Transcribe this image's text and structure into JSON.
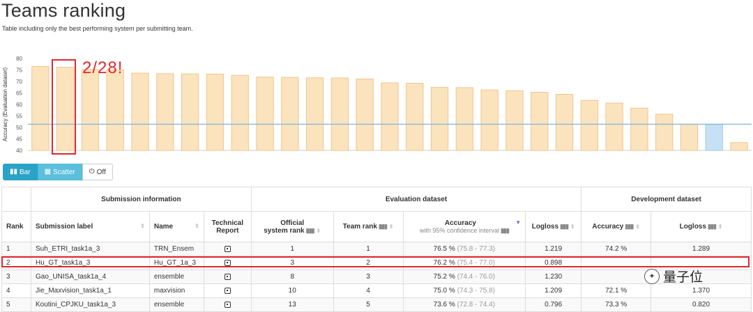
{
  "header": {
    "title": "Teams ranking",
    "subtitle": "Table including only the best performing system per submitting team."
  },
  "annotation": {
    "text": "2/28!"
  },
  "chart_data": {
    "type": "bar",
    "ylabel": "Accuracy (Evaluation dataset)",
    "ylim": [
      40,
      80
    ],
    "yticks": [
      40,
      45,
      50,
      55,
      60,
      65,
      70,
      75,
      80
    ],
    "values": [
      76.5,
      76.2,
      75.2,
      75.0,
      73.6,
      73.4,
      73.3,
      73.2,
      72.7,
      71.9,
      71.8,
      71.6,
      71.5,
      71.1,
      69.4,
      69.2,
      67.5,
      67.3,
      66.3,
      66.0,
      65.3,
      64.4,
      61.8,
      60.6,
      58.4,
      55.8,
      51.4,
      51.3,
      43.4
    ],
    "baseline": 51.4,
    "highlight_index": 27,
    "colors": {
      "bar": "#fbe3be",
      "bar_stroke": "#f0c58a",
      "highlight_bar": "#c6e0f5",
      "highlight_stroke": "#a3c8e8",
      "baseline": "#7ab8e0"
    }
  },
  "controls": {
    "bar_label": "Bar",
    "scatter_label": "Scatter",
    "off_label": "Off"
  },
  "table": {
    "groups": {
      "submission": "Submission information",
      "evaluation": "Evaluation dataset",
      "development": "Development dataset"
    },
    "columns": {
      "rank": "Rank",
      "label": "Submission label",
      "name": "Name",
      "report_line1": "Technical",
      "report_line2": "Report",
      "official_line1": "Official",
      "official_line2": "system rank",
      "team_rank": "Team rank",
      "accuracy": "Accuracy",
      "accuracy_sub": "with 95% confidence interval",
      "logloss": "Logloss",
      "dev_accuracy": "Accuracy",
      "dev_logloss": "Logloss"
    },
    "rows": [
      {
        "rank": "1",
        "label": "Suh_ETRI_task1a_3",
        "name": "TRN_Ensem",
        "official_rank": "1",
        "team_rank": "1",
        "accuracy": "76.5 %",
        "ci": "(75.8 - 77.3)",
        "logloss": "1.219",
        "dev_accuracy": "74.2 %",
        "dev_logloss": "1.289"
      },
      {
        "rank": "2",
        "label": "Hu_GT_task1a_3",
        "name": "Hu_GT_1a_3",
        "official_rank": "3",
        "team_rank": "2",
        "accuracy": "76.2 %",
        "ci": "(75.4 - 77.0)",
        "logloss": "0.898",
        "dev_accuracy": "",
        "dev_logloss": ""
      },
      {
        "rank": "3",
        "label": "Gao_UNISA_task1a_4",
        "name": "ensemble",
        "official_rank": "8",
        "team_rank": "3",
        "accuracy": "75.2 %",
        "ci": "(74.4 - 76.0)",
        "logloss": "1.230",
        "dev_accuracy": "",
        "dev_logloss": ""
      },
      {
        "rank": "4",
        "label": "Jie_Maxvision_task1a_1",
        "name": "maxvision",
        "official_rank": "10",
        "team_rank": "4",
        "accuracy": "75.0 %",
        "ci": "(74.3 - 75.8)",
        "logloss": "1.209",
        "dev_accuracy": "72.1 %",
        "dev_logloss": "1.370"
      },
      {
        "rank": "5",
        "label": "Koutini_CPJKU_task1a_3",
        "name": "ensemble",
        "official_rank": "13",
        "team_rank": "5",
        "accuracy": "73.6 %",
        "ci": "(72.8 - 74.4)",
        "logloss": "0.796",
        "dev_accuracy": "73.3 %",
        "dev_logloss": "0.820"
      }
    ]
  },
  "watermark": {
    "text": "量子位"
  }
}
